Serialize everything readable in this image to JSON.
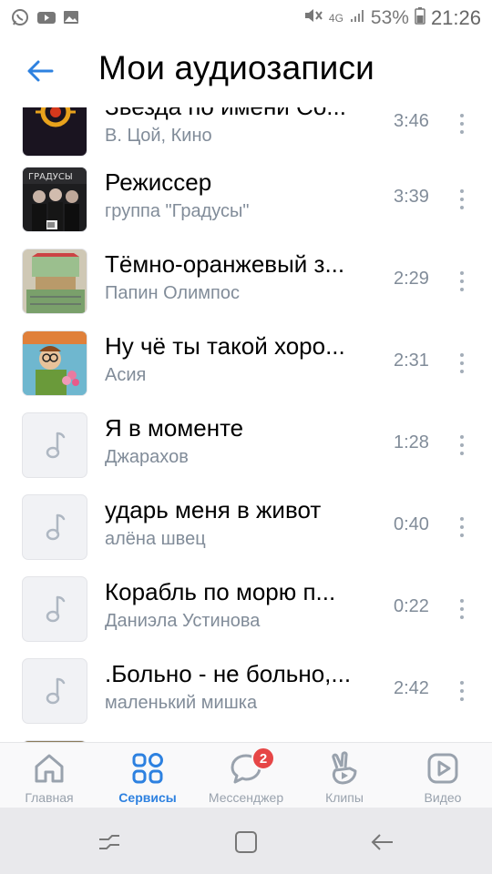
{
  "status_bar": {
    "battery": "53%",
    "time": "21:26",
    "network": "4G"
  },
  "header": {
    "title": "Мои аудиозаписи"
  },
  "tracks": [
    {
      "title": "Звезда по имени Со...",
      "artist": "В. Цой, Кино",
      "duration": "3:46",
      "cover": "kino-star-cover"
    },
    {
      "title": "Режиссер",
      "artist": "группа \"Градусы\"",
      "duration": "3:39",
      "cover": "gradusy-cover"
    },
    {
      "title": "Тёмно-оранжевый з...",
      "artist": "Папин Олимпос",
      "duration": "2:29",
      "cover": "olimpos-cover"
    },
    {
      "title": "Ну чё ты такой хоро...",
      "artist": "Асия",
      "duration": "2:31",
      "cover": "asiya-cover"
    },
    {
      "title": "Я в моменте",
      "artist": "Джарахов",
      "duration": "1:28",
      "cover": "music-note-icon"
    },
    {
      "title": "ударь меня в живот",
      "artist": "алёна швец",
      "duration": "0:40",
      "cover": "music-note-icon"
    },
    {
      "title": "Корабль по морю п...",
      "artist": "Даниэла Устинова",
      "duration": "0:22",
      "cover": "music-note-icon"
    },
    {
      "title": ".Больно - не больно,...",
      "artist": "маленький мишка",
      "duration": "2:42",
      "cover": "music-note-icon"
    }
  ],
  "tabbar": {
    "tabs": [
      {
        "label": "Главная",
        "icon": "home-icon",
        "active": false
      },
      {
        "label": "Сервисы",
        "icon": "services-icon",
        "active": true
      },
      {
        "label": "Мессенджер",
        "icon": "messenger-icon",
        "active": false,
        "badge": "2"
      },
      {
        "label": "Клипы",
        "icon": "clips-icon",
        "active": false
      },
      {
        "label": "Видео",
        "icon": "video-icon",
        "active": false
      }
    ]
  },
  "colors": {
    "accent": "#2d81e0",
    "secondary_text": "#818c99",
    "badge": "#e64646"
  }
}
